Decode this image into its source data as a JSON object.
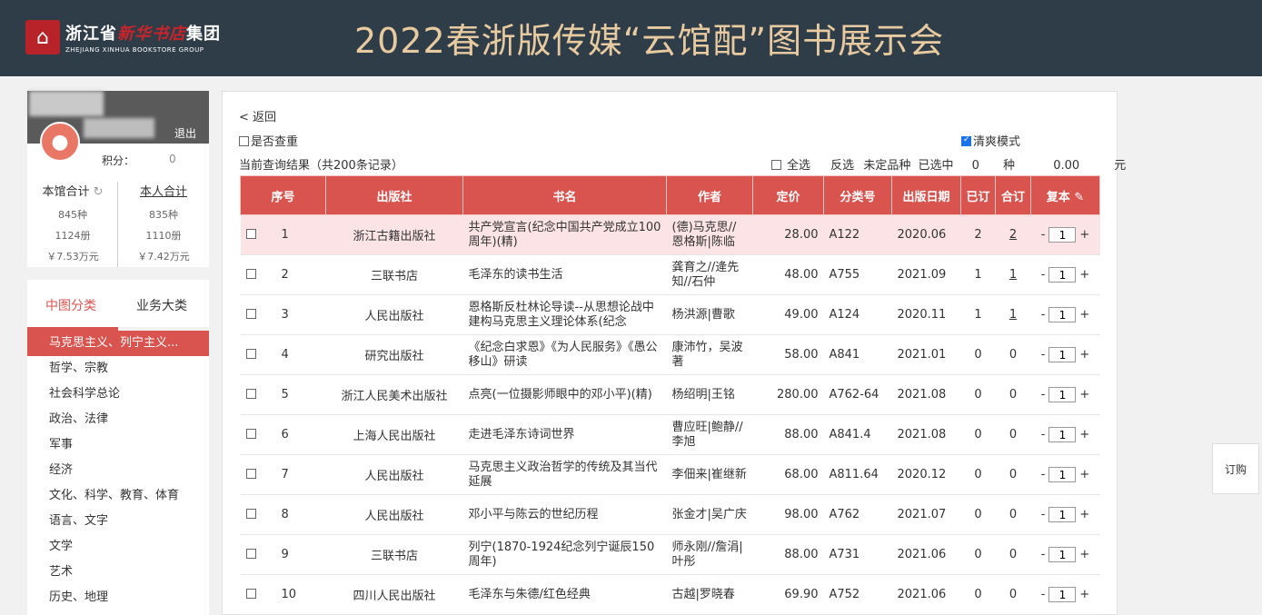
{
  "header": {
    "logo_cn_left": "浙江省",
    "logo_cn_script": "新华书店",
    "logo_cn_right": "集团",
    "logo_en": "ZHEJIANG XINHUA BOOKSTORE GROUP",
    "title": "2022春浙版传媒“云馆配”图书展示会"
  },
  "user": {
    "logout": "退出",
    "points_label": "积分：",
    "points_value": "0",
    "library_total_label": "本馆合计",
    "personal_total_label": "本人合计",
    "library": {
      "kinds": "845种",
      "copies": "1124册",
      "amount": "￥7.53万元"
    },
    "personal": {
      "kinds": "835种",
      "copies": "1110册",
      "amount": "￥7.42万元"
    }
  },
  "categories": {
    "tab_active": "中图分类",
    "tab_other": "业务大类",
    "items": [
      "马克思主义、列宁主义...",
      "哲学、宗教",
      "社会科学总论",
      "政治、法律",
      "军事",
      "经济",
      "文化、科学、教育、体育",
      "语言、文字",
      "文学",
      "艺术",
      "历史、地理"
    ]
  },
  "main": {
    "back": "< 返回",
    "dedup_label": "是否查重",
    "cool_mode_label": "清爽模式",
    "result_text": "当前查询结果（共200条记录）",
    "select_all": "全选",
    "invert": "反选",
    "undecided": "未定品种",
    "selected_label": "已选中",
    "selected_count": "0",
    "kind_unit": "种",
    "selected_amount": "0.00",
    "currency_unit": "元"
  },
  "table": {
    "headers": [
      "序号",
      "出版社",
      "书名",
      "作者",
      "定价",
      "分类号",
      "出版日期",
      "已订",
      "合订",
      "复本"
    ],
    "rows": [
      {
        "no": "1",
        "publisher": "浙江古籍出版社",
        "title": "共产党宣言(纪念中国共产党成立100周年)(精)",
        "author": "(德)马克思//恩格斯|陈临",
        "price": "28.00",
        "class": "A122",
        "date": "2020.06",
        "ordered": "2",
        "total": "2",
        "qty": "1"
      },
      {
        "no": "2",
        "publisher": "三联书店",
        "title": "毛泽东的读书生活",
        "author": "龚育之//逄先知//石仲",
        "price": "48.00",
        "class": "A755",
        "date": "2021.09",
        "ordered": "1",
        "total": "1",
        "qty": "1"
      },
      {
        "no": "3",
        "publisher": "人民出版社",
        "title": "恩格斯反杜林论导读--从思想论战中建构马克思主义理论体系(纪念",
        "author": "杨洪源|曹歌",
        "price": "49.00",
        "class": "A124",
        "date": "2020.11",
        "ordered": "1",
        "total": "1",
        "qty": "1"
      },
      {
        "no": "4",
        "publisher": "研究出版社",
        "title": "《纪念白求恩》《为人民服务》《愚公移山》研读",
        "author": "康沛竹，吴波著",
        "price": "58.00",
        "class": "A841",
        "date": "2021.01",
        "ordered": "0",
        "total": "0",
        "qty": "1"
      },
      {
        "no": "5",
        "publisher": "浙江人民美术出版社",
        "title": "点亮(一位摄影师眼中的邓小平)(精)",
        "author": "杨绍明|王铭",
        "price": "280.00",
        "class": "A762-64",
        "date": "2021.08",
        "ordered": "0",
        "total": "0",
        "qty": "1"
      },
      {
        "no": "6",
        "publisher": "上海人民出版社",
        "title": "走进毛泽东诗词世界",
        "author": "曹应旺|鲍静//李旭",
        "price": "88.00",
        "class": "A841.4",
        "date": "2021.08",
        "ordered": "0",
        "total": "0",
        "qty": "1"
      },
      {
        "no": "7",
        "publisher": "人民出版社",
        "title": "马克思主义政治哲学的传统及其当代延展",
        "author": "李佃来|崔继新",
        "price": "68.00",
        "class": "A811.64",
        "date": "2020.12",
        "ordered": "0",
        "total": "0",
        "qty": "1"
      },
      {
        "no": "8",
        "publisher": "人民出版社",
        "title": "邓小平与陈云的世纪历程",
        "author": "张金才|吴广庆",
        "price": "98.00",
        "class": "A762",
        "date": "2021.07",
        "ordered": "0",
        "total": "0",
        "qty": "1"
      },
      {
        "no": "9",
        "publisher": "三联书店",
        "title": "列宁(1870-1924纪念列宁诞辰150周年)",
        "author": "师永刚//詹涓|叶彤",
        "price": "88.00",
        "class": "A731",
        "date": "2021.06",
        "ordered": "0",
        "total": "0",
        "qty": "1"
      },
      {
        "no": "10",
        "publisher": "四川人民出版社",
        "title": "毛泽东与朱德/红色经典",
        "author": "古越|罗晓春",
        "price": "69.90",
        "class": "A752",
        "date": "2021.06",
        "ordered": "0",
        "total": "0",
        "qty": "1"
      }
    ]
  },
  "float": {
    "order_button": "订购"
  }
}
